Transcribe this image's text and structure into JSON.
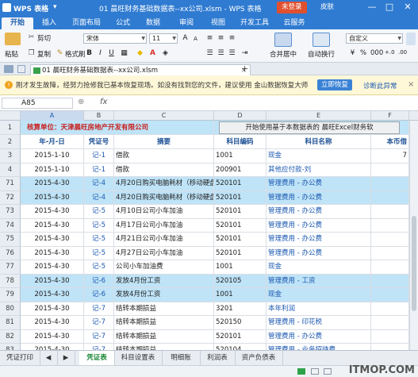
{
  "titlebar": {
    "app_name": "WPS 表格",
    "app_menu_arrow": "▾",
    "doc_title": "01 晨旺财务基础数据表--xx公司.xlsm - WPS 表格",
    "login_label": "未登录",
    "skin_label": "皮肤",
    "min_glyph": "—",
    "max_glyph": "□",
    "close_glyph": "✕"
  },
  "menu_tabs": [
    "开始",
    "插入",
    "页面布局",
    "公式",
    "数据",
    "审阅",
    "视图",
    "开发工具",
    "云服务"
  ],
  "ribbon": {
    "cut": "剪切",
    "paste": "粘贴",
    "copy": "复制",
    "format_painter": "格式刷",
    "font_name": "宋体",
    "font_size": "11",
    "bold": "B",
    "italic": "I",
    "underline": "U",
    "merge_center": "合并居中",
    "wrap_text": "自动换行",
    "number_format": "自定义",
    "percent": "%",
    "thousands": "000",
    "dec_inc": "+.0",
    "dec_dec": ".00"
  },
  "doc_tabs": {
    "active_tab": "01 晨旺财务基础数据表--xx公司.xlsm",
    "close_glyph": "×",
    "add_glyph": "+"
  },
  "notice": {
    "text": "刚才发生故障，经努力抢修我已基本恢复现场。如没有找到您的文件，建议使用 金山数据恢复大师",
    "restore_button": "立即恢复",
    "diagnose_link": "诊断此异常",
    "close_glyph": "×"
  },
  "formula_bar": {
    "cell_ref": "A85",
    "fx": "fx",
    "formula": ""
  },
  "columns": [
    "A",
    "B",
    "C",
    "D",
    "E",
    "F"
  ],
  "grid": {
    "row1": {
      "rownum": "1",
      "company_label": "核算单位：",
      "company_name": "天津晨旺房地产开发有限公司",
      "start_button": "开始使用基于本数据表的 晨旺Excel财务软"
    },
    "row2": {
      "rownum": "2",
      "headers": [
        "年-月-日",
        "凭证号",
        "摘要",
        "科目编码",
        "科目名称",
        "本币借"
      ]
    },
    "rows": [
      {
        "num": "3",
        "date": "2015-1-10",
        "voucher": "记-1",
        "summary": "借款",
        "code": "1001",
        "name": "现金",
        "amount": "7",
        "hl": false
      },
      {
        "num": "4",
        "date": "2015-1-10",
        "voucher": "记-1",
        "summary": "借款",
        "code": "200901",
        "name": "其他应付款-刘",
        "amount": "",
        "hl": false
      },
      {
        "num": "71",
        "date": "2015-4-30",
        "voucher": "记-4",
        "summary": "4月20日购买电脑耗材（移动硬盘",
        "code": "520101",
        "name": "管理费用 - 办公费",
        "amount": "",
        "hl": true
      },
      {
        "num": "72",
        "date": "2015-4-30",
        "voucher": "记-4",
        "summary": "4月20日购买电脑耗材（移动硬盘",
        "code": "520101",
        "name": "管理费用 - 办公费",
        "amount": "",
        "hl": true
      },
      {
        "num": "73",
        "date": "2015-4-30",
        "voucher": "记-5",
        "summary": "4月10日公司小车加油",
        "code": "520101",
        "name": "管理费用 - 办公费",
        "amount": "",
        "hl": false
      },
      {
        "num": "74",
        "date": "2015-4-30",
        "voucher": "记-5",
        "summary": "4月17日公司小车加油",
        "code": "520101",
        "name": "管理费用 - 办公费",
        "amount": "",
        "hl": false
      },
      {
        "num": "75",
        "date": "2015-4-30",
        "voucher": "记-5",
        "summary": "4月21日公司小车加油",
        "code": "520101",
        "name": "管理费用 - 办公费",
        "amount": "",
        "hl": false
      },
      {
        "num": "76",
        "date": "2015-4-30",
        "voucher": "记-5",
        "summary": "4月27日公司小车加油",
        "code": "520101",
        "name": "管理费用 - 办公费",
        "amount": "",
        "hl": false
      },
      {
        "num": "77",
        "date": "2015-4-30",
        "voucher": "记-5",
        "summary": "公司小车加油费",
        "code": "1001",
        "name": "现金",
        "amount": "",
        "hl": false
      },
      {
        "num": "78",
        "date": "2015-4-30",
        "voucher": "记-6",
        "summary": "发放4月份工资",
        "code": "520105",
        "name": "管理费用 - 工资",
        "amount": "",
        "hl": true
      },
      {
        "num": "79",
        "date": "2015-4-30",
        "voucher": "记-6",
        "summary": "发放4月份工资",
        "code": "1001",
        "name": "现金",
        "amount": "",
        "hl": true
      },
      {
        "num": "80",
        "date": "2015-4-30",
        "voucher": "记-7",
        "summary": "结转本期损益",
        "code": "3201",
        "name": "本年利润",
        "amount": "",
        "hl": false
      },
      {
        "num": "81",
        "date": "2015-4-30",
        "voucher": "记-7",
        "summary": "结转本期损益",
        "code": "520150",
        "name": "管理费用 - 印花税",
        "amount": "",
        "hl": false
      },
      {
        "num": "82",
        "date": "2015-4-30",
        "voucher": "记-7",
        "summary": "结转本期损益",
        "code": "520101",
        "name": "管理费用 - 办公费",
        "amount": "",
        "hl": false
      },
      {
        "num": "83",
        "date": "2015-4-30",
        "voucher": "记-7",
        "summary": "结转本期损益",
        "code": "520104",
        "name": "管理费用 - 业务招待费",
        "amount": "",
        "hl": false
      }
    ]
  },
  "sheet_tabs": [
    "凭证打印",
    "凭证表",
    "科目设置表",
    "明细账",
    "利润表",
    "资产负债表"
  ],
  "sheet_nav": [
    "◀",
    "▶"
  ],
  "watermark": "ITMOP.COM"
}
